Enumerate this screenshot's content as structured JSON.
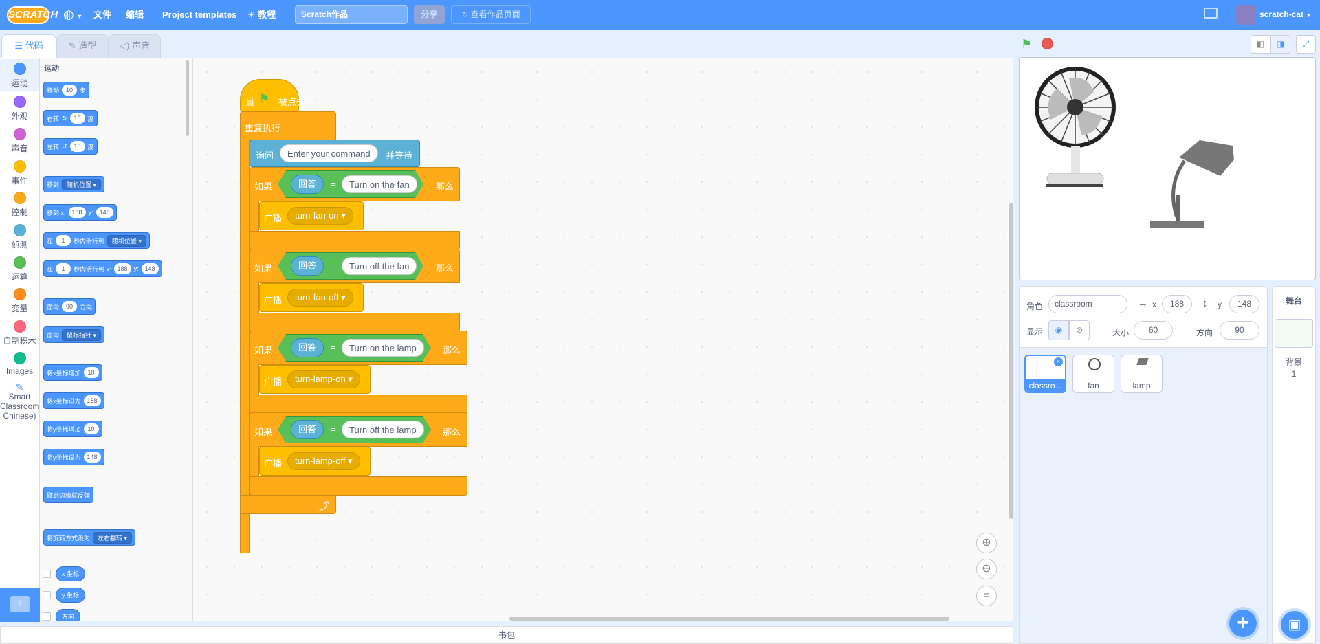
{
  "menubar": {
    "logo": "SCRATCH",
    "file": "文件",
    "edit": "编辑",
    "project_templates": "Project templates",
    "tutorials": "教程",
    "project_title": "Scratch作品",
    "share": "分享",
    "see_project_page": "查看作品页面",
    "username": "scratch-cat"
  },
  "tabs": {
    "code": "代码",
    "costumes": "造型",
    "sounds": "声音"
  },
  "categories": [
    {
      "label": "运动",
      "color": "#4c97ff"
    },
    {
      "label": "外观",
      "color": "#9966ff"
    },
    {
      "label": "声音",
      "color": "#cf63cf"
    },
    {
      "label": "事件",
      "color": "#ffbf00"
    },
    {
      "label": "控制",
      "color": "#ffab19"
    },
    {
      "label": "侦测",
      "color": "#5cb1d6"
    },
    {
      "label": "运算",
      "color": "#59c059"
    },
    {
      "label": "变量",
      "color": "#ff8c1a"
    },
    {
      "label": "自制积木",
      "color": "#ff6680"
    },
    {
      "label": "Images",
      "color": "#0fbd8c"
    },
    {
      "label": "Smart Classroom Chinese)",
      "color": ""
    }
  ],
  "palette": {
    "heading": "运动",
    "move": {
      "label": "移动",
      "value": "10",
      "unit": "步"
    },
    "turn_right": {
      "label": "右转",
      "value": "15",
      "unit": "度"
    },
    "turn_left": {
      "label": "左转",
      "value": "15",
      "unit": "度"
    },
    "goto": {
      "label": "移到",
      "dropdown": "随机位置"
    },
    "goto_xy": {
      "label": "移到 x:",
      "x": "188",
      "ylabel": "y:",
      "y": "148"
    },
    "glide": {
      "pre": "在",
      "secs": "1",
      "label": "秒内滑行到",
      "dropdown": "随机位置"
    },
    "glide_xy": {
      "pre": "在",
      "secs": "1",
      "label": "秒内滑行到 x:",
      "x": "188",
      "ylabel": "y:",
      "y": "148"
    },
    "point_dir": {
      "label": "面向",
      "value": "90",
      "unit": "方向"
    },
    "point_towards": {
      "label": "面向",
      "dropdown": "鼠标指针"
    },
    "change_x": {
      "label": "将x坐标增加",
      "value": "10"
    },
    "set_x": {
      "label": "将x坐标设为",
      "value": "188"
    },
    "change_y": {
      "label": "将y坐标增加",
      "value": "10"
    },
    "set_y": {
      "label": "将y坐标设为",
      "value": "148"
    },
    "bounce": {
      "label": "碰到边缘就反弹"
    },
    "rotation": {
      "label": "将旋转方式设为",
      "dropdown": "左右翻转"
    },
    "xpos": "x 坐标",
    "ypos": "y 坐标",
    "direction": "方向"
  },
  "script": {
    "hat": {
      "pre": "当",
      "post": "被点击"
    },
    "forever": "重复执行",
    "ask": {
      "label": "询问",
      "value": "Enter your command",
      "post": "并等待"
    },
    "if_label": "如果",
    "then_label": "那么",
    "answer": "回答",
    "equals": "=",
    "broadcast_label": "广播",
    "ifs": [
      {
        "compare": "Turn on the fan",
        "message": "turn-fan-on"
      },
      {
        "compare": "Turn off the fan",
        "message": "turn-fan-off"
      },
      {
        "compare": "Turn on the lamp",
        "message": "turn-lamp-on"
      },
      {
        "compare": "Turn off the lamp",
        "message": "turn-lamp-off"
      }
    ]
  },
  "backpack": "书包",
  "sprite_info": {
    "sprite_label": "角色",
    "sprite_name": "classroom",
    "x_label": "x",
    "x": "188",
    "y_label": "y",
    "y": "148",
    "show_label": "显示",
    "size_label": "大小",
    "size": "60",
    "direction_label": "方向",
    "direction": "90"
  },
  "sprites": [
    {
      "name": "classro..."
    },
    {
      "name": "fan"
    },
    {
      "name": "lamp"
    }
  ],
  "stage_panel": {
    "title": "舞台",
    "backdrop_label": "背景",
    "backdrop_count": "1"
  },
  "colors": {
    "accent": "#4c97ff",
    "event": "#ffbf00",
    "control": "#ffab19",
    "sensing": "#5cb1d6",
    "operators": "#59c059"
  }
}
